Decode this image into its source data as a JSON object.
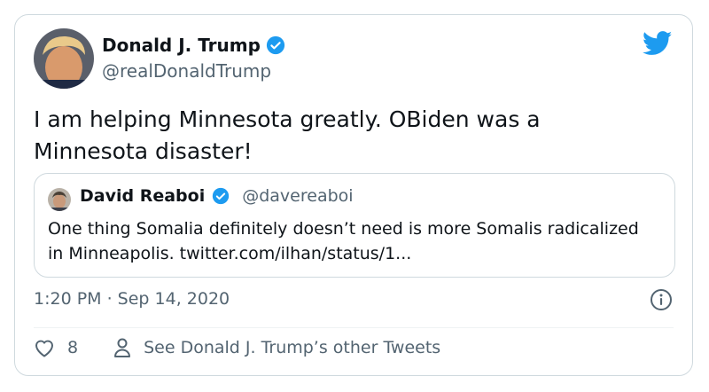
{
  "tweet": {
    "author": {
      "name": "Donald J. Trump",
      "handle": "@realDonaldTrump",
      "verified": true
    },
    "text": "I am helping Minnesota greatly. OBiden was a Minnesota disaster!",
    "quoted": {
      "author": {
        "name": "David Reaboi",
        "handle": "@davereaboi",
        "verified": true
      },
      "text": "One thing Somalia definitely doesn’t need is more Somalis radicalized in Minneapolis. twitter.com/ilhan/status/1..."
    },
    "timestamp": "1:20 PM · Sep 14, 2020",
    "likes": "8",
    "see_more_label": "See Donald J. Trump’s other Tweets"
  },
  "colors": {
    "brand": "#1d9bf0",
    "verified": "#1d9bf0",
    "secondary_text": "#536471",
    "border": "#cfd9de"
  },
  "icons": [
    "twitter-bird-icon",
    "verified-icon",
    "info-icon",
    "heart-icon",
    "person-icon"
  ]
}
